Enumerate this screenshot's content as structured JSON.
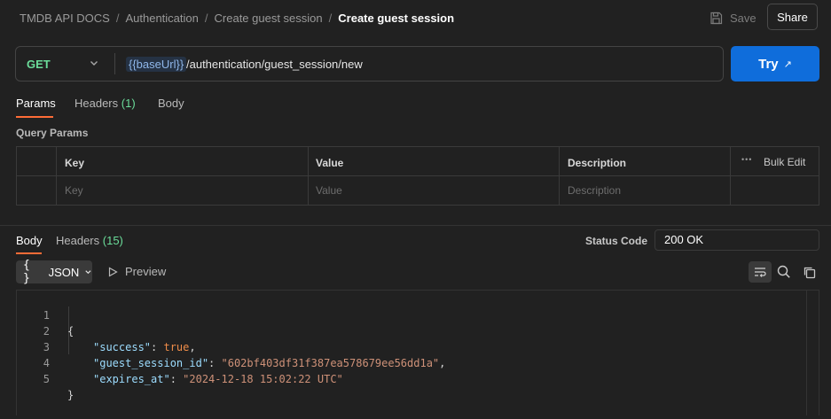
{
  "breadcrumb": {
    "items": [
      "TMDB API DOCS",
      "Authentication",
      "Create guest session"
    ],
    "separator": "/",
    "current": "Create guest session"
  },
  "toolbar": {
    "save_label": "Save",
    "share_label": "Share"
  },
  "request": {
    "method": "GET",
    "url_variable": "{{baseUrl}}",
    "url_path": " /authentication/guest_session/new",
    "try_label": "Try",
    "try_arrow": "↗"
  },
  "request_tabs": [
    {
      "label": "Params",
      "count": ""
    },
    {
      "label": "Headers",
      "count": "(1)"
    },
    {
      "label": "Body",
      "count": ""
    }
  ],
  "query_params": {
    "title": "Query Params",
    "columns": [
      "Key",
      "Value",
      "Description"
    ],
    "bulk_edit_label": "Bulk Edit",
    "more_label": "•••",
    "placeholders": [
      "Key",
      "Value",
      "Description"
    ]
  },
  "response": {
    "tabs": [
      {
        "label": "Body",
        "count": ""
      },
      {
        "label": "Headers",
        "count": "(15)"
      }
    ],
    "status_label": "Status Code",
    "status_value": "200 OK",
    "format_label": "JSON",
    "format_braces": "{ }",
    "preview_label": "Preview"
  },
  "code_lines": [
    {
      "n": "1",
      "open": "{"
    },
    {
      "n": "2",
      "key": "\"success\"",
      "sep": ": ",
      "value": "true",
      "trail": ","
    },
    {
      "n": "3",
      "key": "\"guest_session_id\"",
      "sep": ": ",
      "value": "\"602bf403df31f387ea578679ee56dd1a\"",
      "trail": ","
    },
    {
      "n": "4",
      "key": "\"expires_at\"",
      "sep": ": ",
      "value": "\"2024-12-18 15:02:22 UTC\"",
      "trail": ""
    },
    {
      "n": "5",
      "close": "}"
    }
  ],
  "colors": {
    "accent_tab": "#ff6c37",
    "try_button": "#0f6ddb",
    "method_get": "#6bdd9a",
    "json_key": "#9cdcfe",
    "json_string": "#ce9178",
    "json_bool": "#f08d49"
  },
  "icons": [
    "save-icon",
    "chevron-down-icon",
    "external-arrow-icon",
    "more-icon",
    "play-icon",
    "wrap-lines-icon",
    "search-icon",
    "copy-icon"
  ]
}
